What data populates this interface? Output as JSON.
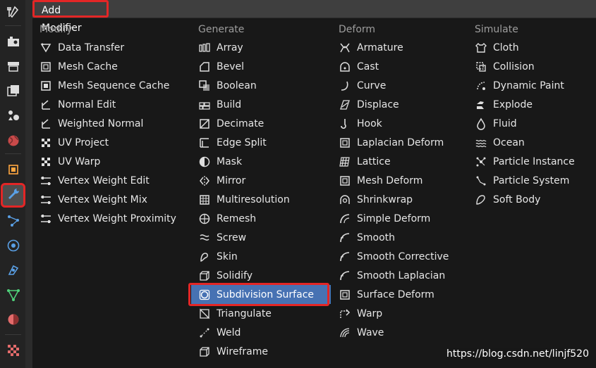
{
  "menu": {
    "title": "Add Modifier",
    "columns": [
      {
        "title": "Modify",
        "items": [
          {
            "label": "Data Transfer",
            "icon": "data-transfer-icon"
          },
          {
            "label": "Mesh Cache",
            "icon": "mesh-cache-icon"
          },
          {
            "label": "Mesh Sequence Cache",
            "icon": "mesh-sequence-cache-icon"
          },
          {
            "label": "Normal Edit",
            "icon": "normal-edit-icon"
          },
          {
            "label": "Weighted Normal",
            "icon": "weighted-normal-icon"
          },
          {
            "label": "UV Project",
            "icon": "uv-project-icon"
          },
          {
            "label": "UV Warp",
            "icon": "uv-warp-icon"
          },
          {
            "label": "Vertex Weight Edit",
            "icon": "vertex-weight-icon"
          },
          {
            "label": "Vertex Weight Mix",
            "icon": "vertex-weight-icon"
          },
          {
            "label": "Vertex Weight Proximity",
            "icon": "vertex-weight-icon"
          }
        ]
      },
      {
        "title": "Generate",
        "items": [
          {
            "label": "Array",
            "icon": "array-icon"
          },
          {
            "label": "Bevel",
            "icon": "bevel-icon"
          },
          {
            "label": "Boolean",
            "icon": "boolean-icon"
          },
          {
            "label": "Build",
            "icon": "build-icon"
          },
          {
            "label": "Decimate",
            "icon": "decimate-icon"
          },
          {
            "label": "Edge Split",
            "icon": "edge-split-icon"
          },
          {
            "label": "Mask",
            "icon": "mask-icon"
          },
          {
            "label": "Mirror",
            "icon": "mirror-icon"
          },
          {
            "label": "Multiresolution",
            "icon": "multiresolution-icon"
          },
          {
            "label": "Remesh",
            "icon": "remesh-icon"
          },
          {
            "label": "Screw",
            "icon": "screw-icon"
          },
          {
            "label": "Skin",
            "icon": "skin-icon"
          },
          {
            "label": "Solidify",
            "icon": "solidify-icon"
          },
          {
            "label": "Subdivision Surface",
            "icon": "subdivision-surface-icon",
            "selected": true
          },
          {
            "label": "Triangulate",
            "icon": "triangulate-icon"
          },
          {
            "label": "Weld",
            "icon": "weld-icon"
          },
          {
            "label": "Wireframe",
            "icon": "wireframe-icon"
          }
        ]
      },
      {
        "title": "Deform",
        "items": [
          {
            "label": "Armature",
            "icon": "armature-icon"
          },
          {
            "label": "Cast",
            "icon": "cast-icon"
          },
          {
            "label": "Curve",
            "icon": "curve-icon"
          },
          {
            "label": "Displace",
            "icon": "displace-icon"
          },
          {
            "label": "Hook",
            "icon": "hook-icon"
          },
          {
            "label": "Laplacian Deform",
            "icon": "laplacian-deform-icon"
          },
          {
            "label": "Lattice",
            "icon": "lattice-icon"
          },
          {
            "label": "Mesh Deform",
            "icon": "mesh-deform-icon"
          },
          {
            "label": "Shrinkwrap",
            "icon": "shrinkwrap-icon"
          },
          {
            "label": "Simple Deform",
            "icon": "simple-deform-icon"
          },
          {
            "label": "Smooth",
            "icon": "smooth-icon"
          },
          {
            "label": "Smooth Corrective",
            "icon": "smooth-icon"
          },
          {
            "label": "Smooth Laplacian",
            "icon": "smooth-icon"
          },
          {
            "label": "Surface Deform",
            "icon": "surface-deform-icon"
          },
          {
            "label": "Warp",
            "icon": "warp-icon"
          },
          {
            "label": "Wave",
            "icon": "wave-icon"
          }
        ]
      },
      {
        "title": "Simulate",
        "items": [
          {
            "label": "Cloth",
            "icon": "cloth-icon"
          },
          {
            "label": "Collision",
            "icon": "collision-icon"
          },
          {
            "label": "Dynamic Paint",
            "icon": "dynamic-paint-icon"
          },
          {
            "label": "Explode",
            "icon": "explode-icon"
          },
          {
            "label": "Fluid",
            "icon": "fluid-icon"
          },
          {
            "label": "Ocean",
            "icon": "ocean-icon"
          },
          {
            "label": "Particle Instance",
            "icon": "particle-instance-icon"
          },
          {
            "label": "Particle System",
            "icon": "particle-system-icon"
          },
          {
            "label": "Soft Body",
            "icon": "soft-body-icon"
          }
        ]
      }
    ]
  },
  "sidebar": {
    "tabs": [
      {
        "icon": "tool-icon"
      },
      {
        "icon": "render-icon"
      },
      {
        "icon": "output-icon"
      },
      {
        "icon": "view-layer-icon"
      },
      {
        "icon": "scene-icon"
      },
      {
        "icon": "world-icon"
      },
      {
        "icon": "object-icon"
      },
      {
        "icon": "modifier-wrench-icon",
        "active": true
      },
      {
        "icon": "particles-icon"
      },
      {
        "icon": "physics-icon"
      },
      {
        "icon": "constraints-icon"
      },
      {
        "icon": "object-data-icon"
      },
      {
        "icon": "material-icon"
      },
      {
        "icon": "texture-icon"
      }
    ]
  },
  "watermark": "https://blog.csdn.net/linjf520",
  "colors": {
    "selected": "#4772b3",
    "highlight_outline": "#e32626",
    "header": "#3f3f3f",
    "menu_bg": "#181818"
  }
}
